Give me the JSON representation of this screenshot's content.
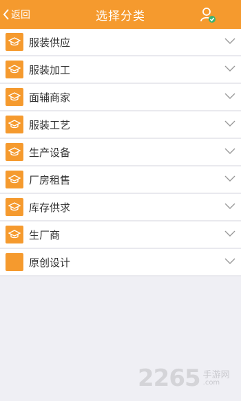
{
  "header": {
    "back_label": "返回",
    "title": "选择分类",
    "user_icon": "user-check-icon"
  },
  "colors": {
    "header_bg": "#f59a2e",
    "icon_bg": "#f59a2e",
    "text": "#333333"
  },
  "categories": [
    {
      "label": "服装供应",
      "icon": "graduation-cap-icon"
    },
    {
      "label": "服装加工",
      "icon": "graduation-cap-icon"
    },
    {
      "label": "面辅商家",
      "icon": "graduation-cap-icon"
    },
    {
      "label": "服装工艺",
      "icon": "graduation-cap-icon"
    },
    {
      "label": "生产设备",
      "icon": "graduation-cap-icon"
    },
    {
      "label": "厂房租售",
      "icon": "graduation-cap-icon"
    },
    {
      "label": "库存供求",
      "icon": "graduation-cap-icon"
    },
    {
      "label": "生厂商",
      "icon": "graduation-cap-icon"
    },
    {
      "label": "原创设计",
      "icon": "blank-square-icon"
    }
  ],
  "watermark": {
    "number": "2265",
    "suffix_cn": "手游网",
    "suffix_en": ".com"
  }
}
